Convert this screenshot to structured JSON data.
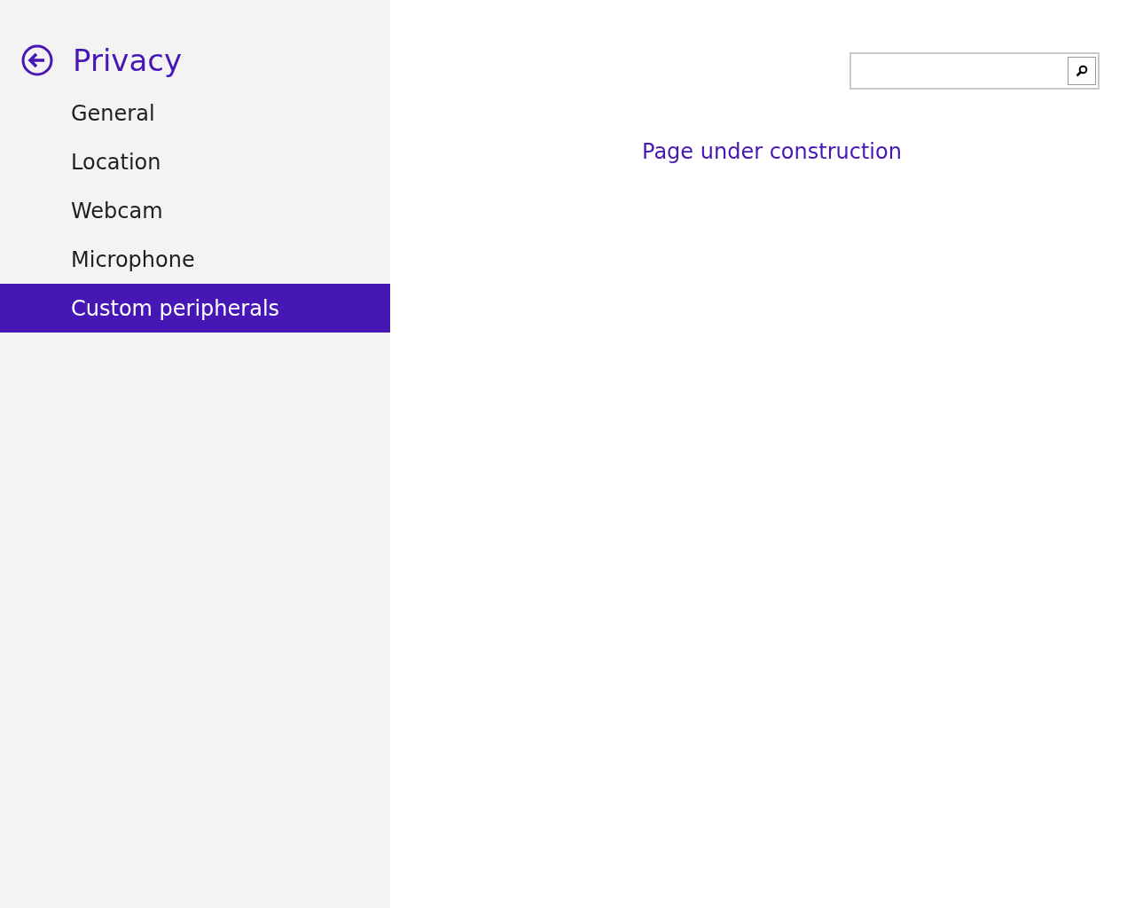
{
  "sidebar": {
    "title": "Privacy",
    "items": [
      {
        "label": "General",
        "selected": false
      },
      {
        "label": "Location",
        "selected": false
      },
      {
        "label": "Webcam",
        "selected": false
      },
      {
        "label": "Microphone",
        "selected": false
      },
      {
        "label": "Custom peripherals",
        "selected": true
      }
    ]
  },
  "content": {
    "message": "Page under construction"
  }
}
